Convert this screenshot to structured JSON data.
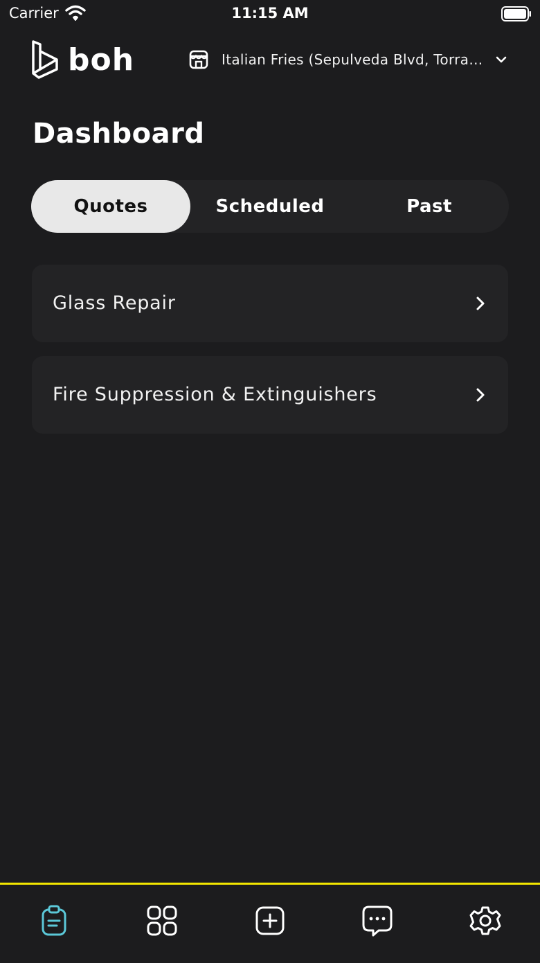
{
  "status_bar": {
    "carrier": "Carrier",
    "time": "11:15 AM"
  },
  "header": {
    "logo_text": "boh",
    "location": "Italian Fries (Sepulveda Blvd, Torrance)"
  },
  "page": {
    "title": "Dashboard"
  },
  "tabs": [
    {
      "label": "Quotes",
      "active": true
    },
    {
      "label": "Scheduled",
      "active": false
    },
    {
      "label": "Past",
      "active": false
    }
  ],
  "quotes": [
    {
      "label": "Glass Repair"
    },
    {
      "label": "Fire Suppression & Extinguishers"
    }
  ],
  "bottom_nav": [
    {
      "icon": "clipboard-icon",
      "active": true
    },
    {
      "icon": "grid-icon",
      "active": false
    },
    {
      "icon": "add-square-icon",
      "active": false
    },
    {
      "icon": "chat-icon",
      "active": false
    },
    {
      "icon": "gear-icon",
      "active": false
    }
  ],
  "colors": {
    "background": "#1c1c1e",
    "card": "#232325",
    "active_tab": "#e8e8e8",
    "accent_line": "#f3e600",
    "active_nav": "#5bc8d8"
  }
}
